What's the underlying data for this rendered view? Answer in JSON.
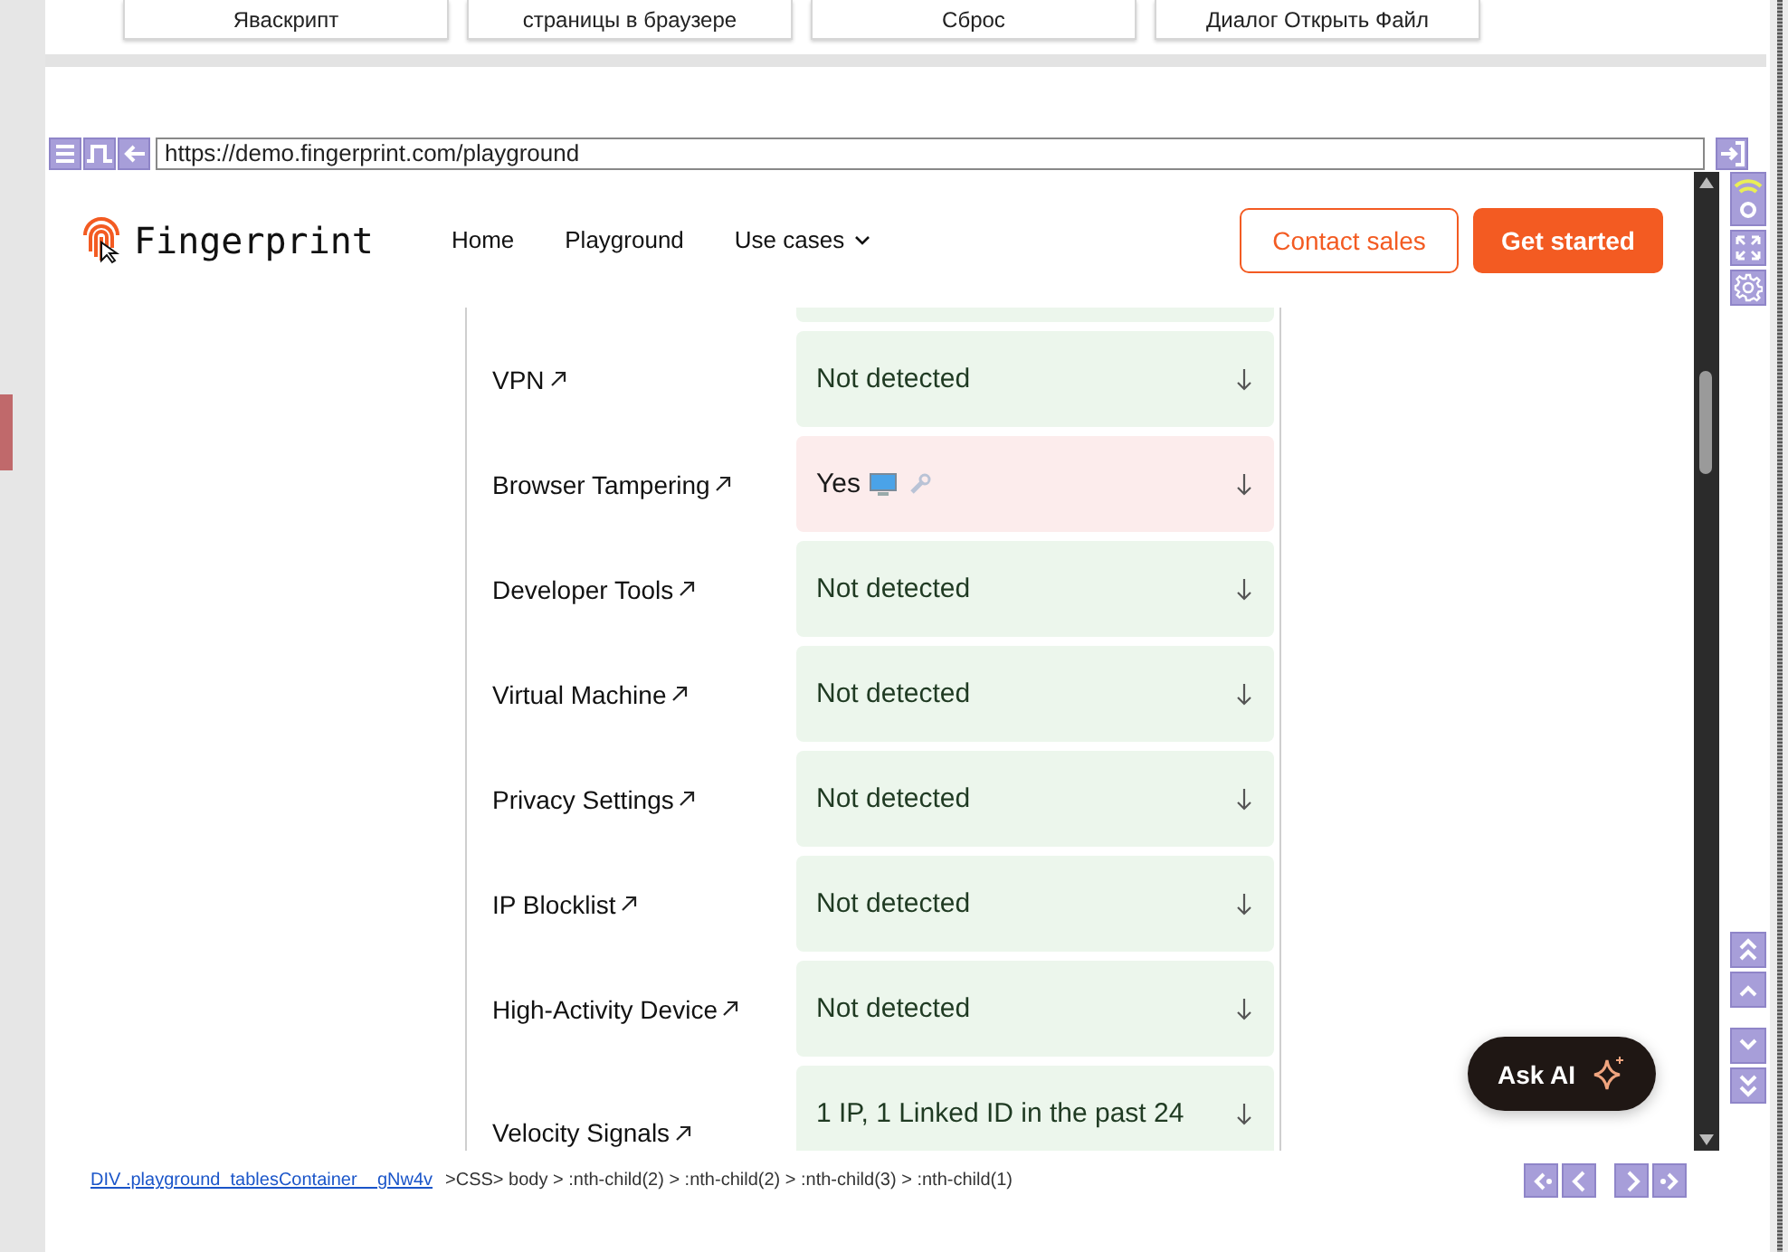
{
  "top_cards": [
    {
      "label": "Яваскрипт"
    },
    {
      "label": "страницы в браузере"
    },
    {
      "label": "Сброс"
    },
    {
      "label": "Диалог Открыть Файл"
    }
  ],
  "address_bar": {
    "value": "https://demo.fingerprint.com/playground"
  },
  "site": {
    "logo": "Fingerprint",
    "nav": [
      {
        "label": "Home",
        "dropdown": false
      },
      {
        "label": "Playground",
        "dropdown": false
      },
      {
        "label": "Use cases",
        "dropdown": true
      }
    ],
    "buttons": [
      {
        "label": "Contact sales",
        "kind": "outline"
      },
      {
        "label": "Get started",
        "kind": "solid"
      }
    ]
  },
  "signals": [
    {
      "label": "VPN",
      "value": "Not detected",
      "detected": false
    },
    {
      "label": "Browser Tampering",
      "value": "Yes",
      "detected": true
    },
    {
      "label": "Developer Tools",
      "value": "Not detected",
      "detected": false
    },
    {
      "label": "Virtual Machine",
      "value": "Not detected",
      "detected": false
    },
    {
      "label": "Privacy Settings",
      "value": "Not detected",
      "detected": false
    },
    {
      "label": "IP Blocklist",
      "value": "Not detected",
      "detected": false
    },
    {
      "label": "High-Activity Device",
      "value": "Not detected",
      "detected": false
    },
    {
      "label": "Velocity Signals",
      "value": "1 IP, 1 Linked ID in the past 24",
      "detected": false
    }
  ],
  "ask_ai": {
    "label": "Ask AI"
  },
  "footer": {
    "element_link": "DIV .playground_tablesContainer__gNw4v",
    "selector": ">CSS> body > :nth-child(2) > :nth-child(2) > :nth-child(3) > :nth-child(1)"
  }
}
